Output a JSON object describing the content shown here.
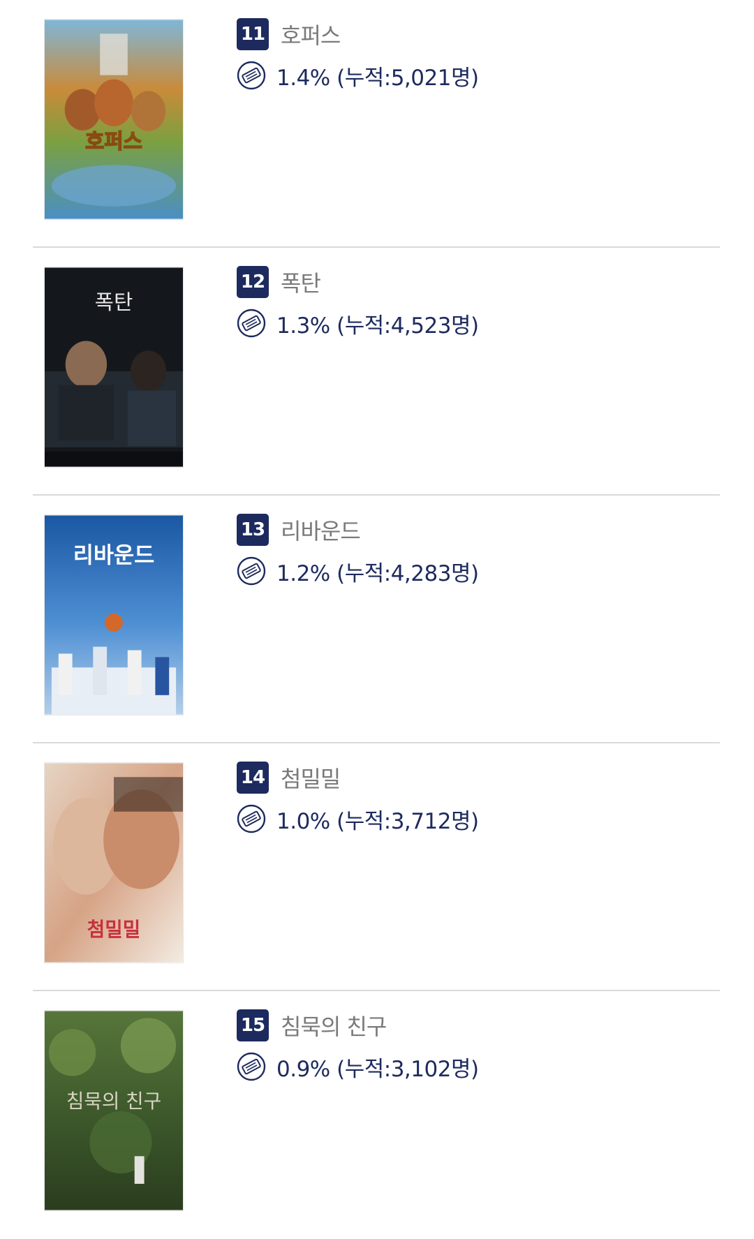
{
  "movies": [
    {
      "rank": "11",
      "title": "호퍼스",
      "share": "1.4%",
      "cumulative": "(누적:5,021명)",
      "poster_text": "호퍼스",
      "colors": {
        "top": "#c98b3a",
        "mid": "#7aa041",
        "bottom": "#4a8fc4"
      }
    },
    {
      "rank": "12",
      "title": "폭탄",
      "share": "1.3%",
      "cumulative": "(누적:4,523명)",
      "poster_text": "폭탄",
      "colors": {
        "top": "#161a1f",
        "mid": "#2a3038",
        "bottom": "#0d1014"
      }
    },
    {
      "rank": "13",
      "title": "리바운드",
      "share": "1.2%",
      "cumulative": "(누적:4,283명)",
      "poster_text": "리바운드",
      "colors": {
        "top": "#1d5ca8",
        "mid": "#4e8ed2",
        "bottom": "#a7c7e6"
      }
    },
    {
      "rank": "14",
      "title": "첨밀밀",
      "share": "1.0%",
      "cumulative": "(누적:3,712명)",
      "poster_text": "첨밀밀",
      "colors": {
        "top": "#e8d6c6",
        "mid": "#d9a98c",
        "bottom": "#f4ece3"
      }
    },
    {
      "rank": "15",
      "title": "침묵의 친구",
      "share": "0.9%",
      "cumulative": "(누적:3,102명)",
      "poster_text": "침묵의 친구",
      "colors": {
        "top": "#3f5e2e",
        "mid": "#5f7d3d",
        "bottom": "#2c3f21"
      }
    }
  ],
  "accent_color": "#1d2a5e",
  "icons": {
    "share": "ticket-icon"
  }
}
